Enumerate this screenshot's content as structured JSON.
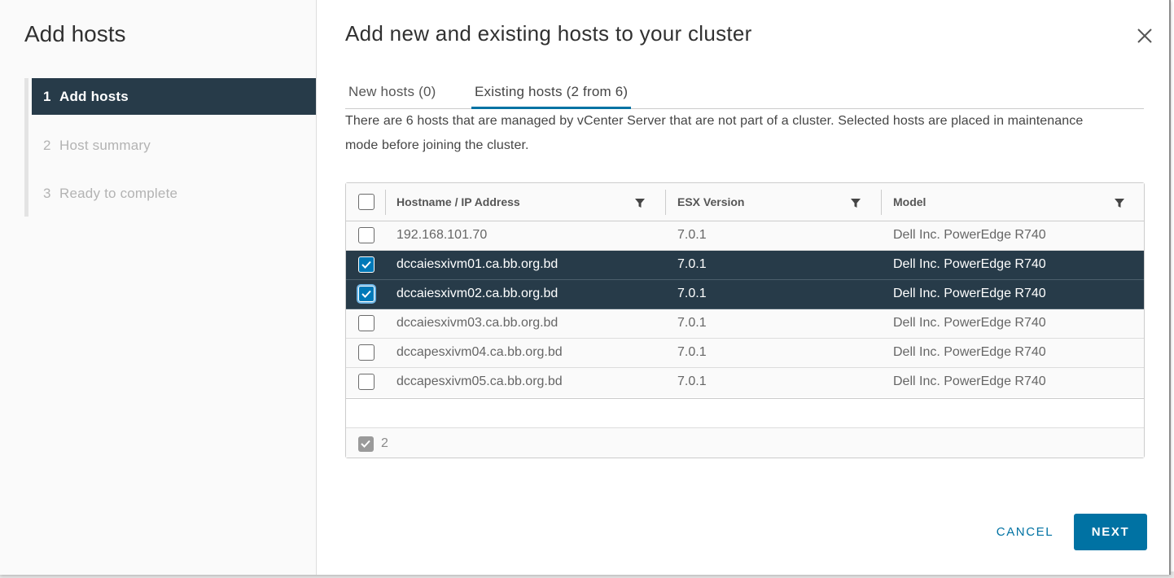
{
  "wizard": {
    "title": "Add hosts",
    "steps": [
      {
        "number": "1",
        "label": "Add hosts",
        "active": true
      },
      {
        "number": "2",
        "label": "Host summary",
        "active": false
      },
      {
        "number": "3",
        "label": "Ready to complete",
        "active": false
      }
    ]
  },
  "dialog": {
    "title": "Add new and existing hosts to your cluster",
    "close_icon": "close-icon",
    "tabs": [
      {
        "label": "New hosts (0)",
        "active": false
      },
      {
        "label": "Existing hosts (2 from 6)",
        "active": true
      }
    ],
    "description": "There are 6 hosts that are managed by vCenter Server that are not part of a cluster. Selected hosts are placed in maintenance mode before joining the cluster."
  },
  "grid": {
    "columns": [
      "Hostname / IP Address",
      "ESX Version",
      "Model"
    ],
    "filter_icon": "filter-icon",
    "rows": [
      {
        "hostname": "192.168.101.70",
        "version": "7.0.1",
        "model": "Dell Inc. PowerEdge R740",
        "selected": false
      },
      {
        "hostname": "dccaiesxivm01.ca.bb.org.bd",
        "version": "7.0.1",
        "model": "Dell Inc. PowerEdge R740",
        "selected": true
      },
      {
        "hostname": "dccaiesxivm02.ca.bb.org.bd",
        "version": "7.0.1",
        "model": "Dell Inc. PowerEdge R740",
        "selected": true
      },
      {
        "hostname": "dccaiesxivm03.ca.bb.org.bd",
        "version": "7.0.1",
        "model": "Dell Inc. PowerEdge R740",
        "selected": false
      },
      {
        "hostname": "dccapesxivm04.ca.bb.org.bd",
        "version": "7.0.1",
        "model": "Dell Inc. PowerEdge R740",
        "selected": false
      },
      {
        "hostname": "dccapesxivm05.ca.bb.org.bd",
        "version": "7.0.1",
        "model": "Dell Inc. PowerEdge R740",
        "selected": false
      }
    ],
    "selected_count": "2"
  },
  "buttons": {
    "cancel": "CANCEL",
    "next": "NEXT"
  },
  "colors": {
    "accent": "#0072a3",
    "selected_row": "#273b49",
    "checkbox_checked": "#0079b8"
  }
}
